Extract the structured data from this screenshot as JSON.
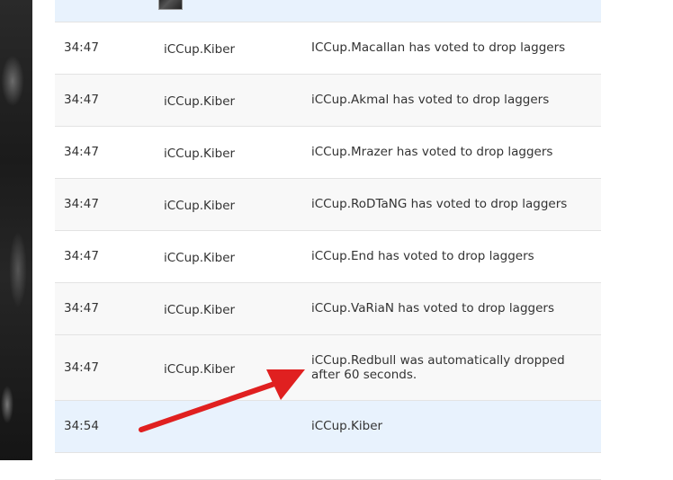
{
  "chat_log": {
    "rows": [
      {
        "time": "",
        "player": "",
        "message": "",
        "has_avatar": true
      },
      {
        "time": "34:47",
        "player": "iCCup.Kiber",
        "message": "ICCup.Macallan has voted to drop laggers"
      },
      {
        "time": "34:47",
        "player": "iCCup.Kiber",
        "message": "iCCup.Akmal has voted to drop laggers"
      },
      {
        "time": "34:47",
        "player": "iCCup.Kiber",
        "message": "iCCup.Mrazer has voted to drop laggers"
      },
      {
        "time": "34:47",
        "player": "iCCup.Kiber",
        "message": "iCCup.RoDTaNG has voted to drop laggers"
      },
      {
        "time": "34:47",
        "player": "iCCup.Kiber",
        "message": "iCCup.End has voted to drop laggers"
      },
      {
        "time": "34:47",
        "player": "iCCup.Kiber",
        "message": "iCCup.VaRiaN has voted to drop laggers"
      },
      {
        "time": "34:47",
        "player": "iCCup.Kiber",
        "message": "iCCup.Redbull was automatically dropped after 60 seconds."
      },
      {
        "time": "34:54",
        "player": "",
        "message": "iCCup.Kiber"
      },
      {
        "time": "",
        "player": "",
        "message": ""
      }
    ]
  },
  "annotation": {
    "arrow_color": "#e02020"
  }
}
